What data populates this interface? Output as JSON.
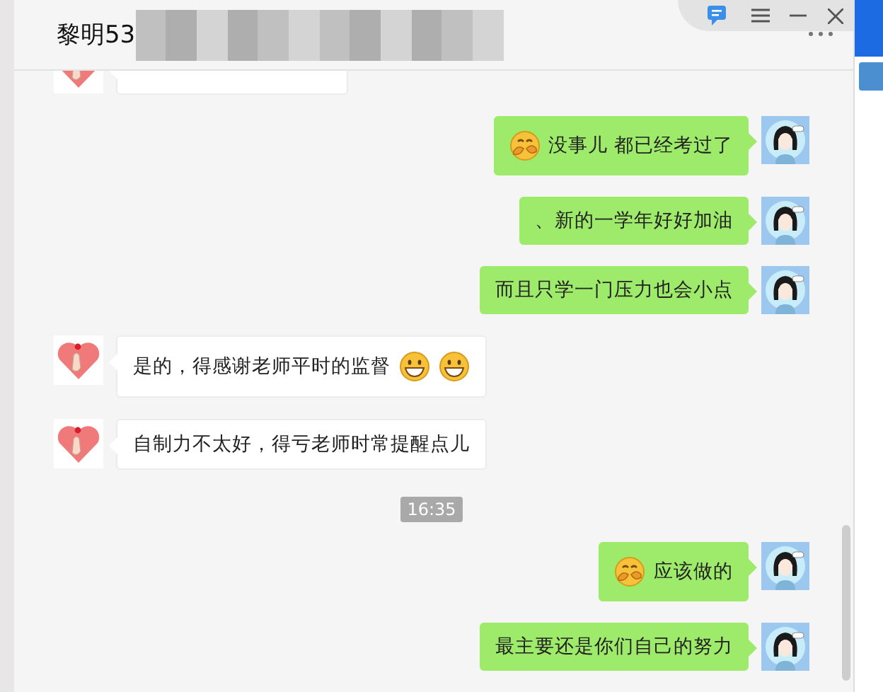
{
  "window": {
    "title": "黎明53"
  },
  "messages": [
    {
      "kind": "message",
      "outgoing": false
    },
    {
      "kind": "message",
      "outgoing": true,
      "parts": [
        {
          "kind": "hug"
        },
        {
          "kind": "text",
          "text": "没事儿 都已经考过了"
        }
      ]
    },
    {
      "kind": "message",
      "outgoing": true,
      "parts": [
        {
          "kind": "text",
          "text": "、新的一学年好好加油"
        }
      ]
    },
    {
      "kind": "message",
      "outgoing": true,
      "parts": [
        {
          "kind": "text",
          "text": "而且只学一门压力也会小点"
        }
      ]
    },
    {
      "kind": "message",
      "outgoing": false,
      "parts": [
        {
          "kind": "text",
          "text": "是的，得感谢老师平时的监督"
        },
        {
          "kind": "grin"
        },
        {
          "kind": "grin"
        }
      ]
    },
    {
      "kind": "message",
      "outgoing": false,
      "parts": [
        {
          "kind": "text",
          "text": "自制力不太好，得亏老师时常提醒点儿"
        }
      ]
    },
    {
      "kind": "time",
      "text": "16:35"
    },
    {
      "kind": "message",
      "outgoing": true,
      "parts": [
        {
          "kind": "hug"
        },
        {
          "kind": "text",
          "text": "应该做的"
        }
      ]
    },
    {
      "kind": "message",
      "outgoing": true,
      "parts": [
        {
          "kind": "text",
          "text": "最主要还是你们自己的努力"
        }
      ]
    }
  ]
}
